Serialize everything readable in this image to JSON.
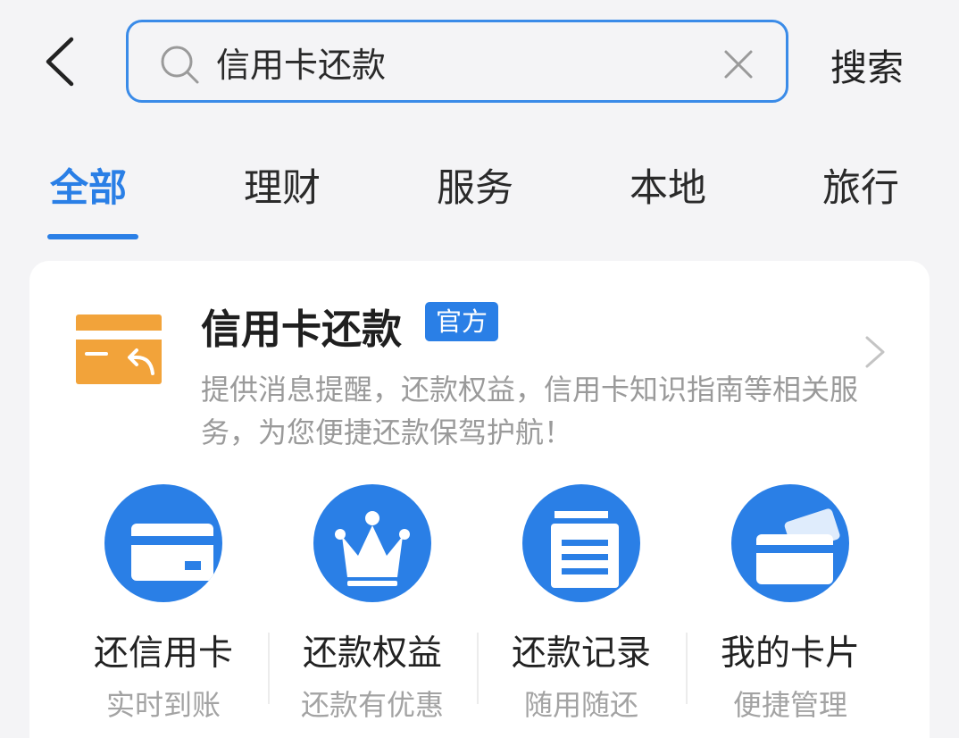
{
  "search": {
    "query": "信用卡还款",
    "search_button": "搜索"
  },
  "tabs": [
    {
      "label": "全部",
      "active": true
    },
    {
      "label": "理财",
      "active": false
    },
    {
      "label": "服务",
      "active": false
    },
    {
      "label": "本地",
      "active": false
    },
    {
      "label": "旅行",
      "active": false
    }
  ],
  "service": {
    "title": "信用卡还款",
    "badge": "官方",
    "description": "提供消息提醒，还款权益，信用卡知识指南等相关服务，为您便捷还款保驾护航！"
  },
  "quick_actions": [
    {
      "title": "还信用卡",
      "subtitle": "实时到账",
      "icon": "credit-card-icon"
    },
    {
      "title": "还款权益",
      "subtitle": "还款有优惠",
      "icon": "crown-icon"
    },
    {
      "title": "还款记录",
      "subtitle": "随用随还",
      "icon": "document-list-icon"
    },
    {
      "title": "我的卡片",
      "subtitle": "便捷管理",
      "icon": "card-stack-icon"
    }
  ],
  "colors": {
    "accent": "#2a7fe6",
    "service_icon": "#f2a33a",
    "text_secondary": "#9a9a9a"
  }
}
